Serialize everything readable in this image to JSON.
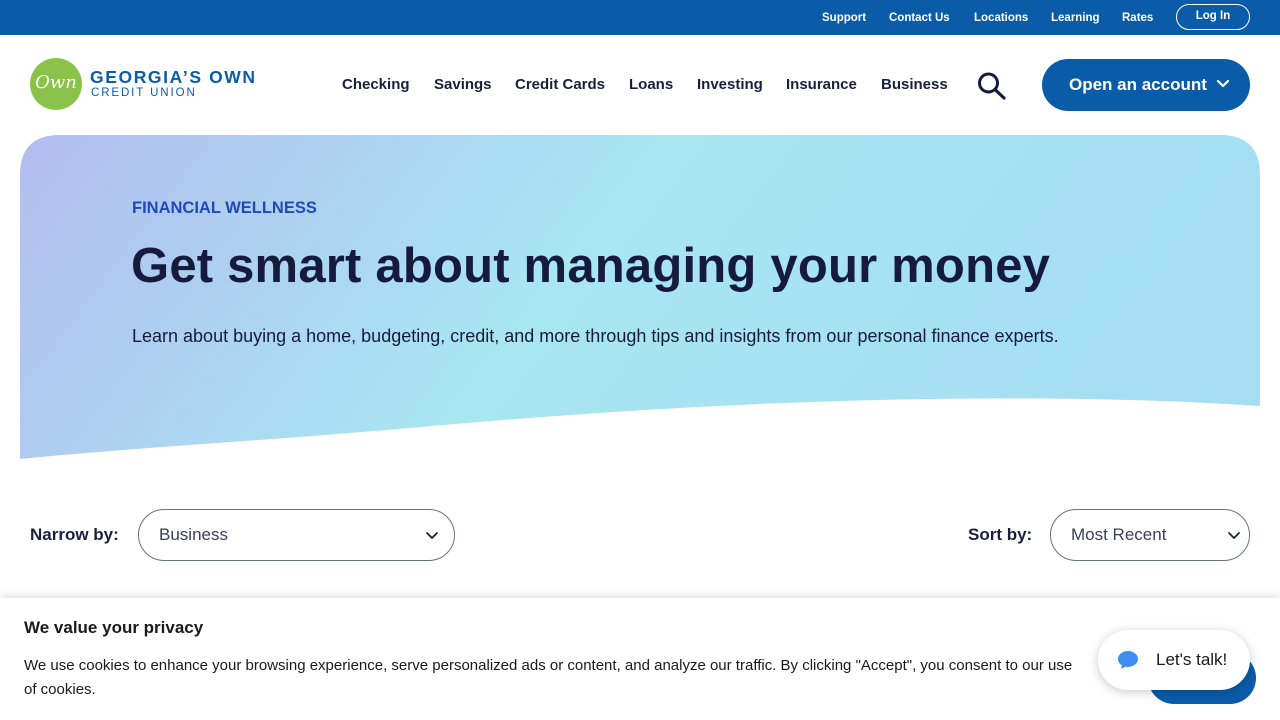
{
  "utility": {
    "links": [
      "Support",
      "Contact Us",
      "Locations",
      "Learning",
      "Rates"
    ],
    "login_label": "Log In"
  },
  "header": {
    "logo_mark": "Own",
    "logo_title": "GEORGIA’S OWN",
    "logo_subtitle": "CREDIT UNION",
    "nav": [
      "Checking",
      "Savings",
      "Credit Cards",
      "Loans",
      "Investing",
      "Insurance",
      "Business"
    ],
    "search_icon": "search-icon",
    "cta_label": "Open an account",
    "cta_icon": "chevron-down-icon"
  },
  "hero": {
    "eyebrow": "FINANCIAL WELLNESS",
    "title": "Get smart about managing your money",
    "description": "Learn about buying a home, budgeting, credit, and more through tips and insights from our personal finance experts."
  },
  "filters": {
    "narrow_label": "Narrow by:",
    "narrow_value": "Business",
    "sort_label": "Sort by:",
    "sort_value": "Most Recent"
  },
  "cookie": {
    "title": "We value your privacy",
    "text": "We use cookies to enhance your browsing experience, serve personalized ads or content, and analyze our traffic. By clicking \"Accept\", you consent to our use of cookies."
  },
  "chat": {
    "label": "Let's talk!",
    "icon": "chat-bubble-icon"
  },
  "colors": {
    "brand_blue": "#0a5ca8",
    "logo_green": "#8bc34a",
    "eyebrow_blue": "#1f4ab8",
    "text_dark": "#161b3d",
    "chat_icon_blue": "#3d8ef0"
  }
}
